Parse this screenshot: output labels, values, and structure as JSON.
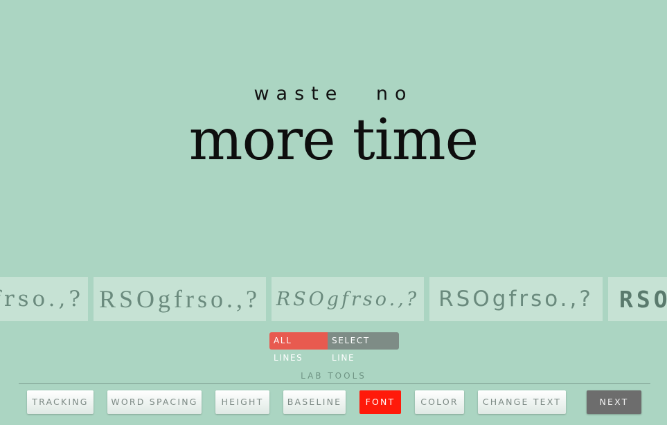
{
  "preview": {
    "line1": "waste no",
    "line2": "more time"
  },
  "font_samples": [
    {
      "text": "frso.,?"
    },
    {
      "text": "RSOgfrso.,?"
    },
    {
      "text": "RSOgfrso.,?"
    },
    {
      "text": "RSOgfrso.,?"
    },
    {
      "text": "RSO"
    }
  ],
  "line_mode": {
    "all_label": "ALL LINES",
    "select_label": "SELECT LINE",
    "selected": "ALL LINES"
  },
  "lab_tools": {
    "heading": "LAB TOOLS",
    "buttons": [
      "TRACKING",
      "WORD SPACING",
      "HEIGHT",
      "BASELINE",
      "FONT",
      "COLOR",
      "CHANGE TEXT"
    ],
    "active": "FONT",
    "next_label": "NEXT"
  },
  "colors": {
    "background": "#abd5c2",
    "sample_tile": "#c6e2d4",
    "active_tool": "#ff1a0a",
    "all_lines_active": "#e85a4f",
    "next_button": "#6d6d6d"
  }
}
